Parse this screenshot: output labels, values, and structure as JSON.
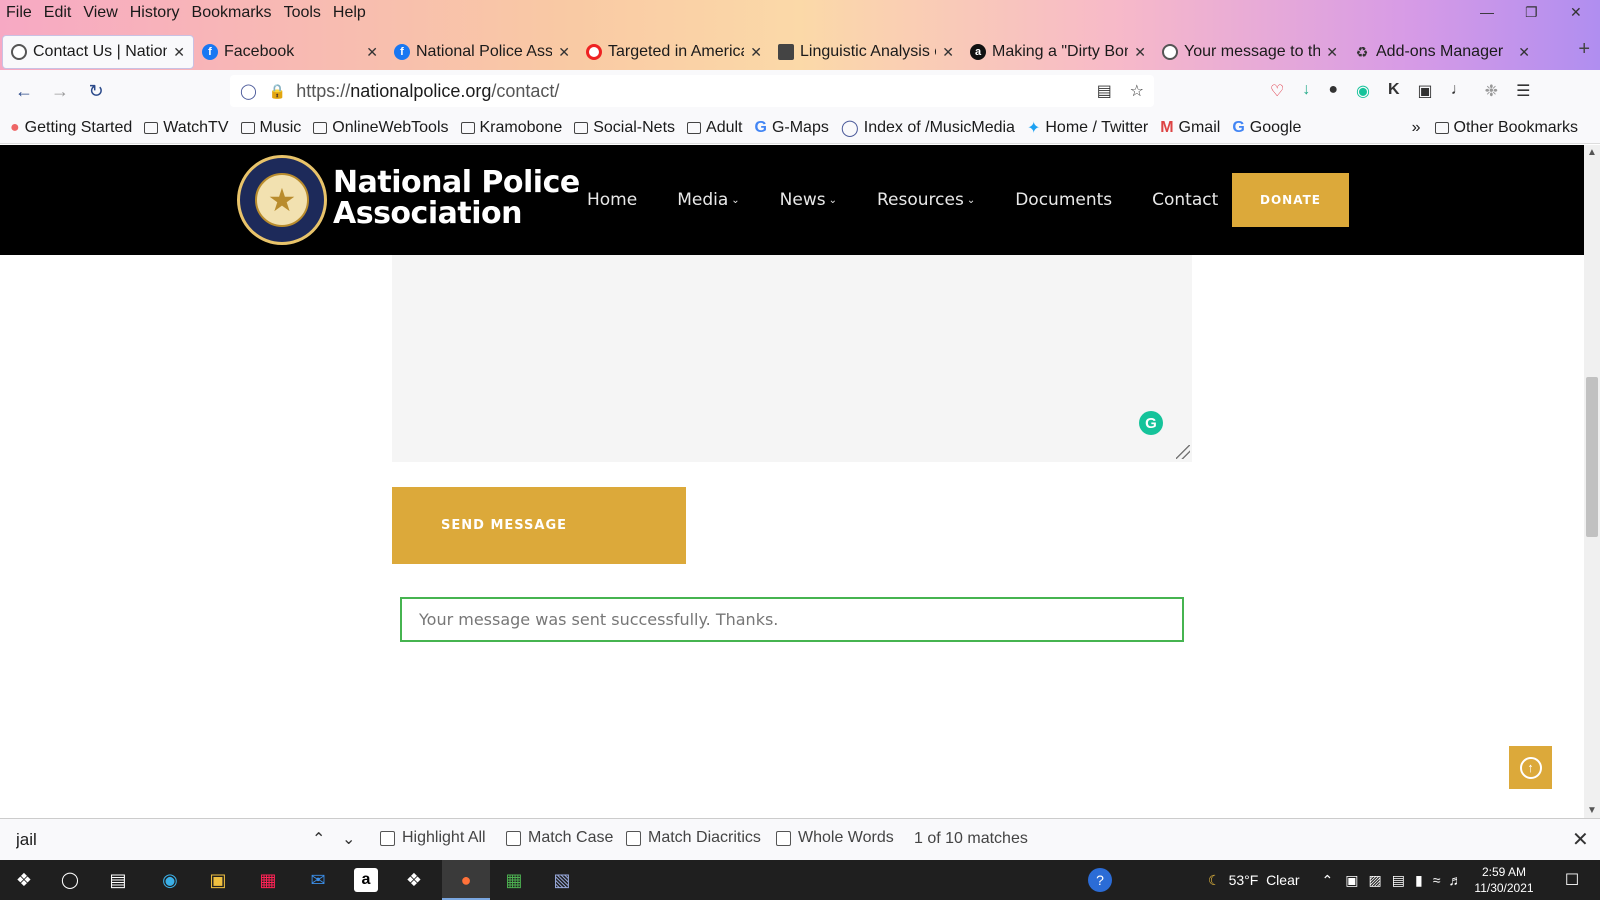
{
  "browser": {
    "menu": [
      "File",
      "Edit",
      "View",
      "History",
      "Bookmarks",
      "Tools",
      "Help"
    ],
    "tabs": [
      {
        "title": "Contact Us | National Police Association"
      },
      {
        "title": "Facebook"
      },
      {
        "title": "National Police Association"
      },
      {
        "title": "Targeted in America"
      },
      {
        "title": "Linguistic Analysis of"
      },
      {
        "title": "Making a \"Dirty Bomb\""
      },
      {
        "title": "Your message to the"
      },
      {
        "title": "Add-ons Manager"
      }
    ],
    "url_prefix": "https://",
    "url_domain": "nationalpolice.org",
    "url_path": "/contact/",
    "bookmarks": [
      "Getting Started",
      "WatchTV",
      "Music",
      "OnlineWebTools",
      "Kramobone",
      "Social-Nets",
      "Adult",
      "G-Maps",
      "Index of /MusicMedia",
      "Home / Twitter",
      "Gmail",
      "Google"
    ],
    "other_bookmarks": "Other Bookmarks"
  },
  "site": {
    "logo_line1": "National Police",
    "logo_line2": "Association",
    "nav": [
      {
        "label": "Home",
        "caret": false
      },
      {
        "label": "Media",
        "caret": true
      },
      {
        "label": "News",
        "caret": true
      },
      {
        "label": "Resources",
        "caret": true
      },
      {
        "label": "Documents",
        "caret": false
      },
      {
        "label": "Contact",
        "caret": false
      }
    ],
    "donate_label": "DONATE",
    "send_label": "SEND MESSAGE",
    "success_message": "Your message was sent successfully. Thanks."
  },
  "findbar": {
    "query": "jail",
    "highlight_all": "Highlight All",
    "match_case": "Match Case",
    "match_diacritics": "Match Diacritics",
    "whole_words": "Whole Words",
    "count": "1 of 10 matches"
  },
  "taskbar": {
    "weather": "53°F  Clear",
    "time": "2:59 AM",
    "date": "11/30/2021"
  },
  "colors": {
    "accent_gold": "#dca93a",
    "success_green": "#46b450",
    "header_black": "#000000"
  }
}
